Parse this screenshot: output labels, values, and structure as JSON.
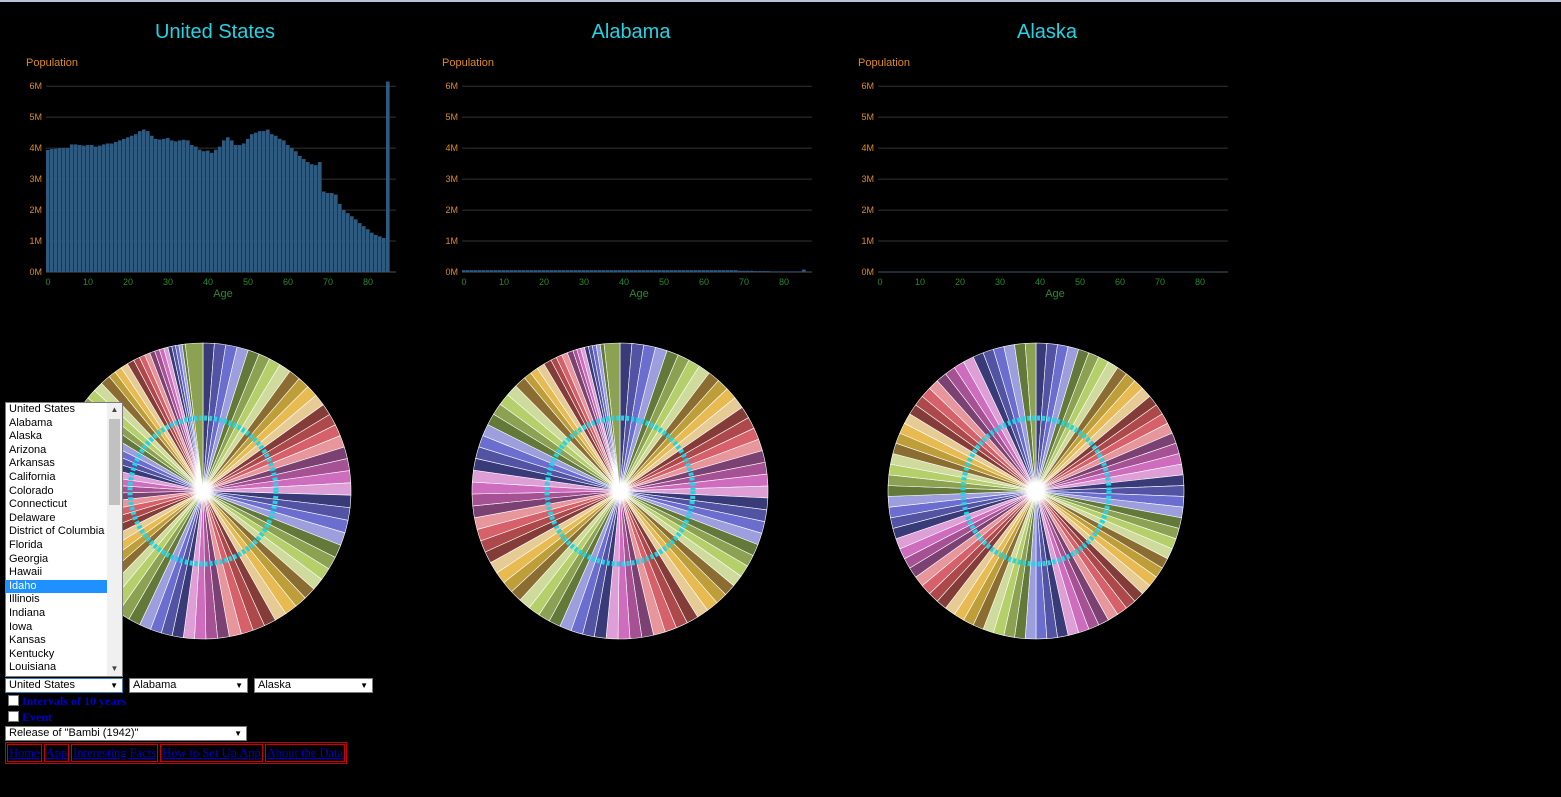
{
  "charts": [
    {
      "title": "United States",
      "ylabel": "Population",
      "xlabel": "Age",
      "yticks": [
        "0M",
        "1M",
        "2M",
        "3M",
        "4M",
        "5M",
        "6M"
      ],
      "xticks": [
        "0",
        "10",
        "20",
        "30",
        "40",
        "50",
        "60",
        "70",
        "80"
      ]
    },
    {
      "title": "Alabama",
      "ylabel": "Population",
      "xlabel": "Age",
      "yticks": [
        "0M",
        "1M",
        "2M",
        "3M",
        "4M",
        "5M",
        "6M"
      ],
      "xticks": [
        "0",
        "10",
        "20",
        "30",
        "40",
        "50",
        "60",
        "70",
        "80"
      ]
    },
    {
      "title": "Alaska",
      "ylabel": "Population",
      "xlabel": "Age",
      "yticks": [
        "0M",
        "1M",
        "2M",
        "3M",
        "4M",
        "5M",
        "6M"
      ],
      "xticks": [
        "0",
        "10",
        "20",
        "30",
        "40",
        "50",
        "60",
        "70",
        "80"
      ]
    }
  ],
  "chart_data": [
    {
      "type": "bar",
      "title": "United States",
      "xlabel": "Age",
      "ylabel": "Population",
      "ylim": [
        0,
        6.2
      ],
      "x": [
        0,
        1,
        2,
        3,
        4,
        5,
        6,
        7,
        8,
        9,
        10,
        11,
        12,
        13,
        14,
        15,
        16,
        17,
        18,
        19,
        20,
        21,
        22,
        23,
        24,
        25,
        26,
        27,
        28,
        29,
        30,
        31,
        32,
        33,
        34,
        35,
        36,
        37,
        38,
        39,
        40,
        41,
        42,
        43,
        44,
        45,
        46,
        47,
        48,
        49,
        50,
        51,
        52,
        53,
        54,
        55,
        56,
        57,
        58,
        59,
        60,
        61,
        62,
        63,
        64,
        65,
        66,
        67,
        68,
        69,
        70,
        71,
        72,
        73,
        74,
        75,
        76,
        77,
        78,
        79,
        80,
        81,
        82,
        83,
        84,
        85
      ],
      "values": [
        3.94,
        3.97,
        3.98,
        4.0,
        4.0,
        4.0,
        4.12,
        4.12,
        4.1,
        4.08,
        4.1,
        4.1,
        4.05,
        4.08,
        4.12,
        4.15,
        4.15,
        4.2,
        4.25,
        4.3,
        4.35,
        4.4,
        4.45,
        4.55,
        4.6,
        4.55,
        4.4,
        4.3,
        4.28,
        4.3,
        4.33,
        4.25,
        4.22,
        4.25,
        4.27,
        4.25,
        4.1,
        4.05,
        3.95,
        3.9,
        3.92,
        3.85,
        3.95,
        4.05,
        4.25,
        4.35,
        4.25,
        4.1,
        4.1,
        4.15,
        4.3,
        4.45,
        4.5,
        4.55,
        4.55,
        4.6,
        4.45,
        4.4,
        4.3,
        4.25,
        4.1,
        4.0,
        3.9,
        3.75,
        3.65,
        3.55,
        3.48,
        3.45,
        3.55,
        2.6,
        2.55,
        2.55,
        2.5,
        2.2,
        2.0,
        1.9,
        1.8,
        1.7,
        1.58,
        1.48,
        1.38,
        1.27,
        1.2,
        1.15,
        1.1,
        6.15
      ]
    },
    {
      "type": "bar",
      "title": "Alabama",
      "xlabel": "Age",
      "ylabel": "Population",
      "ylim": [
        0,
        6.2
      ],
      "x": [
        0,
        1,
        2,
        3,
        4,
        5,
        6,
        7,
        8,
        9,
        10,
        11,
        12,
        13,
        14,
        15,
        16,
        17,
        18,
        19,
        20,
        21,
        22,
        23,
        24,
        25,
        26,
        27,
        28,
        29,
        30,
        31,
        32,
        33,
        34,
        35,
        36,
        37,
        38,
        39,
        40,
        41,
        42,
        43,
        44,
        45,
        46,
        47,
        48,
        49,
        50,
        51,
        52,
        53,
        54,
        55,
        56,
        57,
        58,
        59,
        60,
        61,
        62,
        63,
        64,
        65,
        66,
        67,
        68,
        69,
        70,
        71,
        72,
        73,
        74,
        75,
        76,
        77,
        78,
        79,
        80,
        81,
        82,
        83,
        84,
        85
      ],
      "values": [
        0.06,
        0.06,
        0.06,
        0.06,
        0.06,
        0.06,
        0.06,
        0.06,
        0.06,
        0.06,
        0.06,
        0.06,
        0.06,
        0.06,
        0.06,
        0.06,
        0.06,
        0.06,
        0.06,
        0.06,
        0.06,
        0.06,
        0.06,
        0.06,
        0.06,
        0.06,
        0.06,
        0.06,
        0.06,
        0.06,
        0.06,
        0.06,
        0.06,
        0.06,
        0.06,
        0.06,
        0.06,
        0.06,
        0.06,
        0.06,
        0.06,
        0.06,
        0.06,
        0.06,
        0.06,
        0.06,
        0.06,
        0.06,
        0.06,
        0.06,
        0.06,
        0.06,
        0.06,
        0.06,
        0.06,
        0.06,
        0.06,
        0.06,
        0.06,
        0.06,
        0.06,
        0.06,
        0.06,
        0.06,
        0.06,
        0.06,
        0.06,
        0.06,
        0.06,
        0.04,
        0.04,
        0.04,
        0.04,
        0.03,
        0.03,
        0.03,
        0.03,
        0.02,
        0.02,
        0.02,
        0.02,
        0.02,
        0.02,
        0.02,
        0.02,
        0.08
      ]
    },
    {
      "type": "bar",
      "title": "Alaska",
      "xlabel": "Age",
      "ylabel": "Population",
      "ylim": [
        0,
        6.2
      ],
      "x": [
        0,
        1,
        2,
        3,
        4,
        5,
        6,
        7,
        8,
        9,
        10,
        11,
        12,
        13,
        14,
        15,
        16,
        17,
        18,
        19,
        20,
        21,
        22,
        23,
        24,
        25,
        26,
        27,
        28,
        29,
        30,
        31,
        32,
        33,
        34,
        35,
        36,
        37,
        38,
        39,
        40,
        41,
        42,
        43,
        44,
        45,
        46,
        47,
        48,
        49,
        50,
        51,
        52,
        53,
        54,
        55,
        56,
        57,
        58,
        59,
        60,
        61,
        62,
        63,
        64,
        65,
        66,
        67,
        68,
        69,
        70,
        71,
        72,
        73,
        74,
        75,
        76,
        77,
        78,
        79,
        80,
        81,
        82,
        83,
        84,
        85
      ],
      "values": [
        0.01,
        0.01,
        0.01,
        0.01,
        0.01,
        0.01,
        0.01,
        0.01,
        0.01,
        0.01,
        0.01,
        0.01,
        0.01,
        0.01,
        0.01,
        0.01,
        0.01,
        0.01,
        0.01,
        0.01,
        0.01,
        0.01,
        0.01,
        0.01,
        0.01,
        0.01,
        0.01,
        0.01,
        0.01,
        0.01,
        0.01,
        0.01,
        0.01,
        0.01,
        0.01,
        0.01,
        0.01,
        0.01,
        0.01,
        0.01,
        0.01,
        0.01,
        0.01,
        0.01,
        0.01,
        0.01,
        0.01,
        0.01,
        0.01,
        0.01,
        0.01,
        0.01,
        0.01,
        0.01,
        0.01,
        0.01,
        0.01,
        0.01,
        0.01,
        0.01,
        0.01,
        0.01,
        0.01,
        0.01,
        0.01,
        0.01,
        0.01,
        0.01,
        0.01,
        0.01,
        0.01,
        0.01,
        0.01,
        0.01,
        0.01,
        0.01,
        0.01,
        0.01,
        0.01,
        0.01,
        0.01,
        0.01,
        0.01,
        0.01,
        0.01,
        0.01
      ]
    }
  ],
  "pie": {
    "slices": 86,
    "colors": [
      "#393b79",
      "#5254a3",
      "#6b6ecf",
      "#9c9ede",
      "#637939",
      "#8ca252",
      "#b5cf6b",
      "#cedb9c",
      "#8c6d31",
      "#bd9e39",
      "#e7ba52",
      "#e7cb94",
      "#843c39",
      "#ad494a",
      "#d6616b",
      "#e7969c",
      "#7b4173",
      "#a55194",
      "#ce6dbd",
      "#de9ed6"
    ],
    "ring_color": "#22d4e4"
  },
  "listbox": {
    "options": [
      "United States",
      "Alabama",
      "Alaska",
      "Arizona",
      "Arkansas",
      "California",
      "Colorado",
      "Connecticut",
      "Delaware",
      "District of Columbia",
      "Florida",
      "Georgia",
      "Hawaii",
      "Idaho",
      "Illinois",
      "Indiana",
      "Iowa",
      "Kansas",
      "Kentucky",
      "Louisiana"
    ],
    "selected": "Idaho"
  },
  "selects": {
    "region1": "United States",
    "region2": "Alabama",
    "region3": "Alaska",
    "event": "Release of \"Bambi (1942)\""
  },
  "checkboxes": {
    "intervals": "Intervals of 10 years",
    "event": "Event"
  },
  "nav": [
    "Home",
    "App",
    "Interesting Facts",
    "How to Set Up App",
    "About the Data"
  ],
  "colors": {
    "title": "#22d4e4",
    "axis_label": "#e08a1e",
    "x_axis": "#2a8a2a",
    "bar": "#2e5a80",
    "grid": "#333333"
  }
}
